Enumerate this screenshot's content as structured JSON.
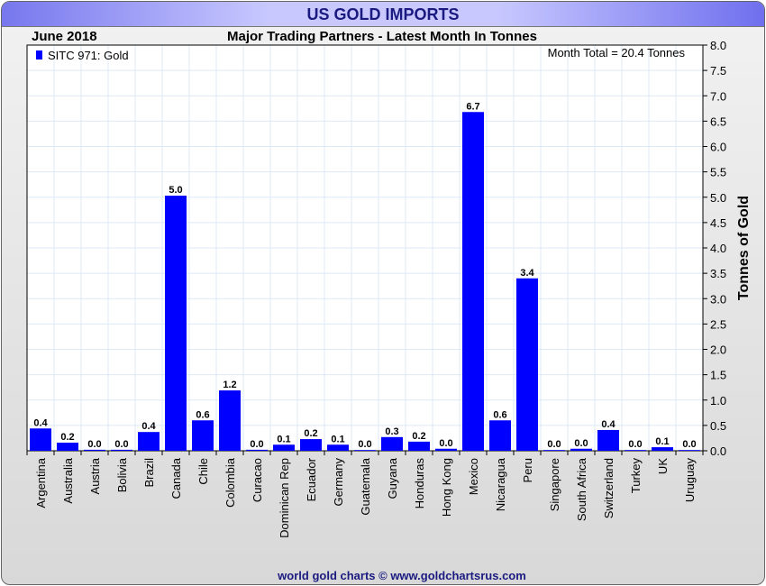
{
  "chart_data": {
    "type": "bar",
    "title": "US GOLD IMPORTS",
    "subtitle": "Major Trading Partners - Latest Month In Tonnes",
    "date_label": "June 2018",
    "annotation": "Month Total = 20.4 Tonnes",
    "legend": {
      "label": "SITC 971: Gold",
      "position": "top-left"
    },
    "ylabel": "Tonnes of Gold",
    "ylim": [
      0,
      8
    ],
    "yticks": [
      "0.0",
      "0.5",
      "1.0",
      "1.5",
      "2.0",
      "2.5",
      "3.0",
      "3.5",
      "4.0",
      "4.5",
      "5.0",
      "5.5",
      "6.0",
      "6.5",
      "7.0",
      "7.5",
      "8.0"
    ],
    "grid": true,
    "color": "#0000ff",
    "categories": [
      "Argentina",
      "Australia",
      "Austria",
      "Bolivia",
      "Brazil",
      "Canada",
      "Chile",
      "Colombia",
      "Curacao",
      "Dominican Rep",
      "Ecuador",
      "Germany",
      "Guatemala",
      "Guyana",
      "Honduras",
      "Hong Kong",
      "Mexico",
      "Nicaragua",
      "Peru",
      "Singapore",
      "South Africa",
      "Switzerland",
      "Turkey",
      "UK",
      "Uruguay"
    ],
    "values": [
      0.44,
      0.16,
      0.02,
      0.02,
      0.37,
      5.03,
      0.6,
      1.19,
      0.02,
      0.12,
      0.23,
      0.12,
      0.0,
      0.27,
      0.18,
      0.04,
      6.68,
      0.6,
      3.4,
      0.0,
      0.04,
      0.41,
      0.0,
      0.07,
      0.0
    ],
    "data_labels": [
      "0.4",
      "0.2",
      "0.0",
      "0.0",
      "0.4",
      "5.0",
      "0.6",
      "1.2",
      "0.0",
      "0.1",
      "0.2",
      "0.1",
      "0.0",
      "0.3",
      "0.2",
      "0.0",
      "6.7",
      "0.6",
      "3.4",
      "0.0",
      "0.0",
      "0.4",
      "0.0",
      "0.1",
      "0.0"
    ]
  },
  "footer": "world gold charts © www.goldchartsrus.com"
}
